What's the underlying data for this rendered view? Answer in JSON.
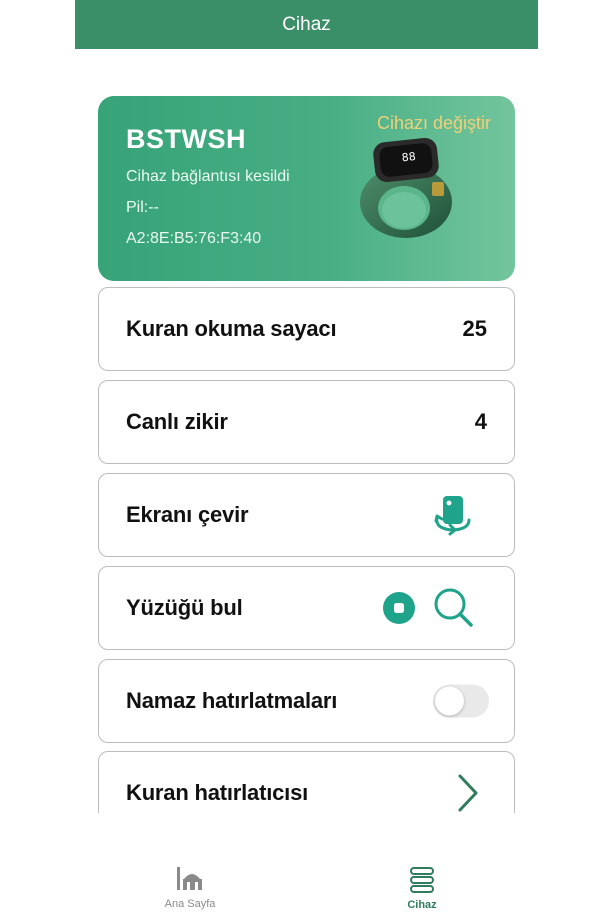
{
  "header": {
    "title": "Cihaz"
  },
  "device": {
    "name": "BSTWSH",
    "status": "Cihaz bağlantısı kesildi",
    "battery": "Pil:--",
    "mac": "A2:8E:B5:76:F3:40",
    "change_label": "Cihazı değiştir",
    "ring_display": "88"
  },
  "rows": {
    "quran_counter": {
      "label": "Kuran okuma sayacı",
      "value": "25"
    },
    "live_dhikr": {
      "label": "Canlı zikir",
      "value": "4"
    },
    "rotate_screen": {
      "label": "Ekranı çevir"
    },
    "find_ring": {
      "label": "Yüzüğü bul"
    },
    "prayer_reminders": {
      "label": "Namaz hatırlatmaları",
      "enabled": false
    },
    "quran_reminder": {
      "label": "Kuran hatırlatıcısı"
    }
  },
  "bottom_nav": {
    "home_label": "Ana Sayfa",
    "device_label": "Cihaz",
    "active": "device"
  },
  "colors": {
    "header_green": "#3a8f68",
    "accent_teal": "#1fa38a",
    "card_green": "#48ae84",
    "change_device_gold": "#f1d07a",
    "nav_active": "#2f7d5c",
    "nav_inactive": "#8a8a8a"
  },
  "icons": {
    "rotate": "rotate-screen-icon",
    "stop": "stop-circle-icon",
    "search": "search-icon",
    "chevron": "chevron-right-icon",
    "home": "mosque-icon",
    "device": "ring-stack-icon"
  }
}
